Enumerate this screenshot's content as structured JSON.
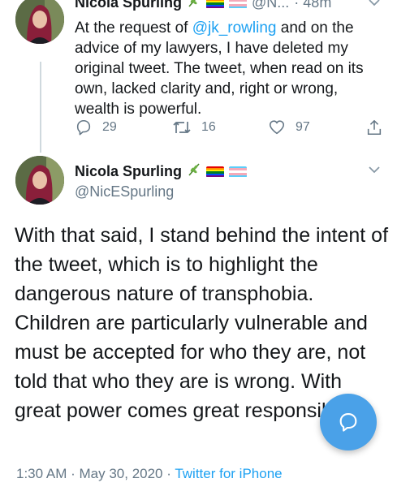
{
  "prev_tweet": {
    "name": "Nicola Spurling",
    "handle_partial": "@N...",
    "time_partial": "· 48m",
    "text_before_mention": "At the request of ",
    "mention": "@jk_rowling",
    "text_after_mention": " and on the advice of my lawyers, I have deleted my original tweet. The tweet, when read on its own, lacked clarity and, right or wrong, wealth is powerful.",
    "replies": "29",
    "retweets": "16",
    "likes": "97"
  },
  "tweet": {
    "name": "Nicola Spurling",
    "handle": "@NicESpurling",
    "text": "With that said, I stand behind the intent of the tweet, which is to highlight the dangerous nature of transphobia. Children are particularly vulnerable and must be accepted for who they are, not told that who they are is wrong. With great power comes great responsibility.",
    "time": "1:30 AM",
    "date": "May 30, 2020",
    "source": "Twitter for iPhone"
  },
  "icons": {
    "name_emoji": "herb-icon",
    "flag1": "rainbow-flag-icon",
    "flag2": "transgender-flag-icon",
    "reply": "reply-icon",
    "retweet": "retweet-icon",
    "like": "heart-icon",
    "share": "share-icon",
    "menu": "chevron-down-icon",
    "compose": "compose-reply-icon"
  },
  "colors": {
    "accent": "#1da1f2",
    "muted": "#657786",
    "fab": "#4aa1e8"
  }
}
